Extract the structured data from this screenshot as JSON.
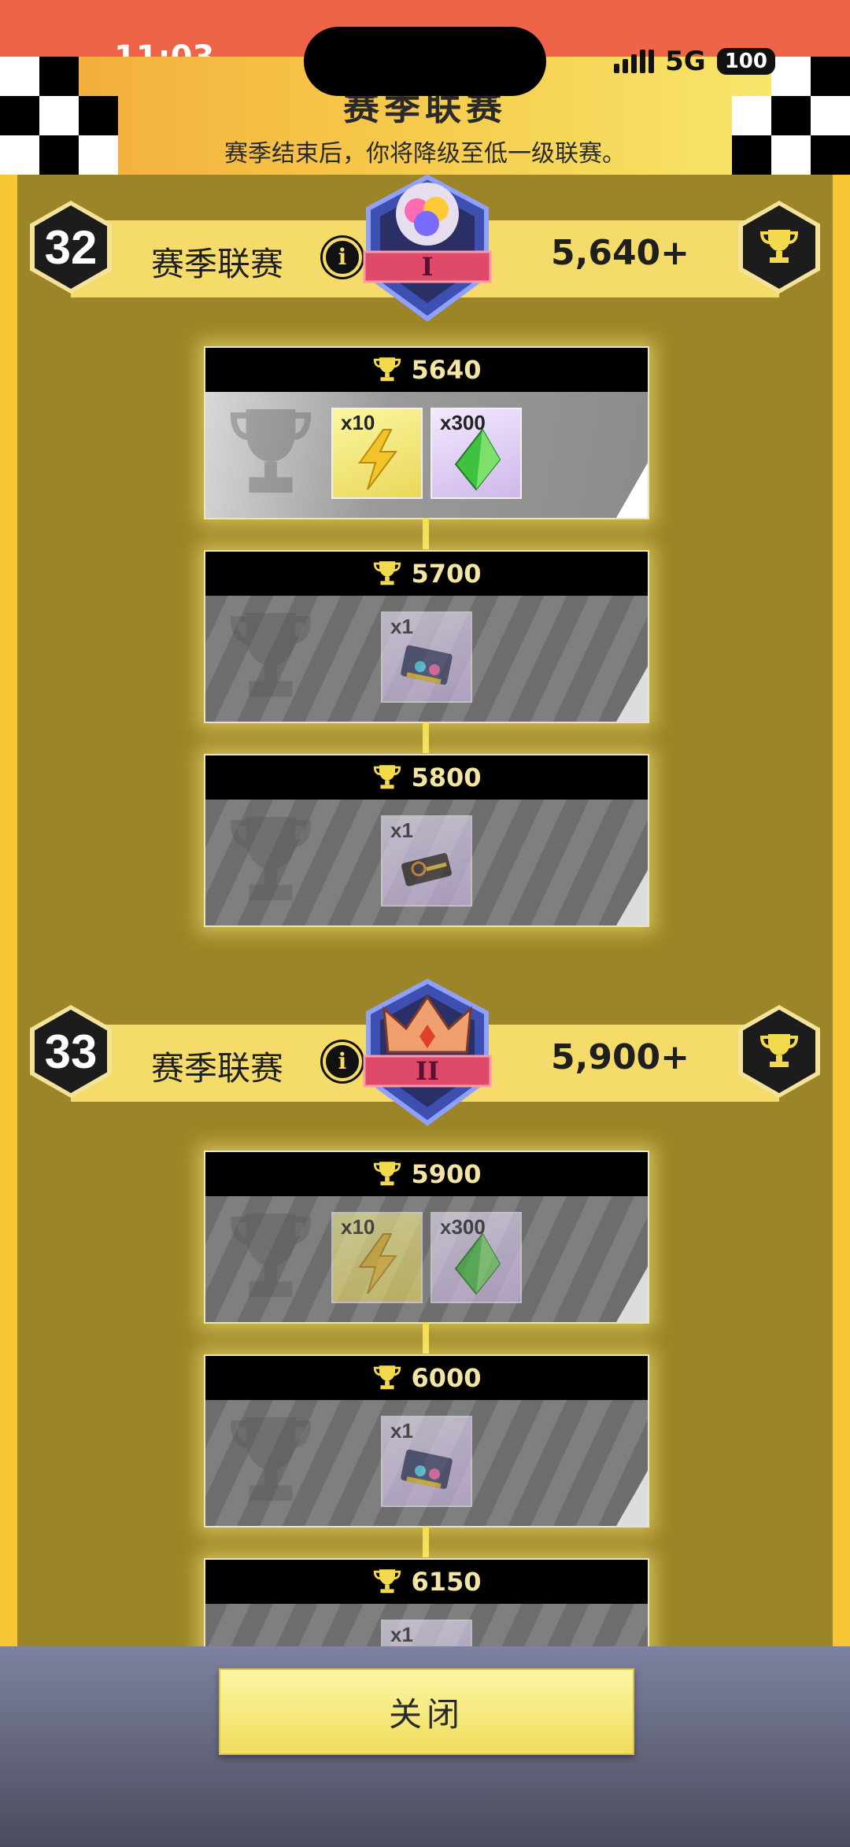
{
  "status_bar": {
    "time": "11:03",
    "network": "5G",
    "battery": "100"
  },
  "banner": {
    "title": "赛季联赛",
    "subtitle": "赛季结束后，你将降级至低一级联赛。"
  },
  "leagues": [
    {
      "number": "32",
      "name": "赛季联赛",
      "threshold": "5,640+",
      "badge_numeral": "I"
    },
    {
      "number": "33",
      "name": "赛季联赛",
      "threshold": "5,900+",
      "badge_numeral": "II"
    }
  ],
  "reward_cards": [
    {
      "trophies": "5640",
      "items": [
        {
          "qty": "x10",
          "icon": "lightning-icon"
        },
        {
          "qty": "x300",
          "icon": "green-gem-icon"
        }
      ]
    },
    {
      "trophies": "5700",
      "items": [
        {
          "qty": "x1",
          "icon": "card-pack-icon"
        }
      ]
    },
    {
      "trophies": "5800",
      "items": [
        {
          "qty": "x1",
          "icon": "ticket-icon"
        }
      ]
    },
    {
      "trophies": "5900",
      "items": [
        {
          "qty": "x10",
          "icon": "lightning-icon"
        },
        {
          "qty": "x300",
          "icon": "green-gem-icon"
        }
      ]
    },
    {
      "trophies": "6000",
      "items": [
        {
          "qty": "x1",
          "icon": "card-pack-icon"
        }
      ]
    },
    {
      "trophies": "6150",
      "items": [
        {
          "qty": "x1",
          "icon": "card-pack-icon"
        }
      ]
    }
  ],
  "footer": {
    "close_label": "关闭"
  },
  "colors": {
    "background": "#9c8428",
    "accent_yellow": "#f5dc6a",
    "status_bar": "#ee6448"
  }
}
